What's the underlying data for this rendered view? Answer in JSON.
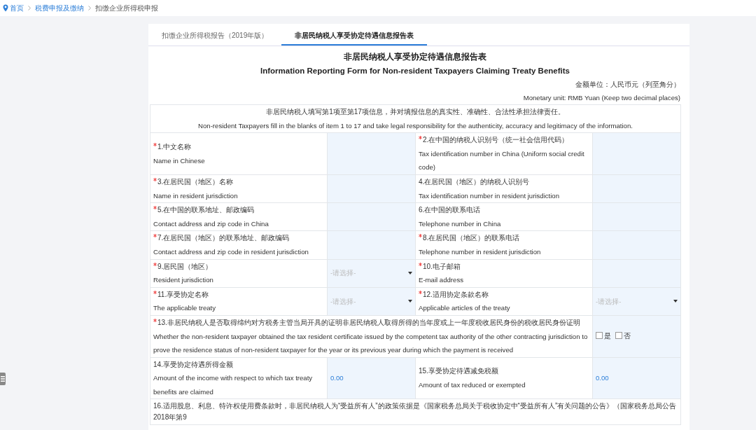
{
  "breadcrumb": [
    {
      "label": "首页",
      "kind": "home"
    },
    {
      "label": "税费申报及缴纳",
      "kind": "link"
    },
    {
      "label": "扣缴企业所得税申报",
      "kind": "current"
    }
  ],
  "tabs": [
    {
      "label": "扣缴企业所得税报告（2019年版）",
      "selected": false
    },
    {
      "label": "非居民纳税人享受协定待遇信息报告表",
      "selected": true
    }
  ],
  "form": {
    "title_zh": "非居民纳税人享受协定待遇信息报告表",
    "title_en": "Information Reporting Form for Non-resident Taxpayers Claiming Treaty Benefits",
    "unit_zh": "金额单位：人民币元（列至角分）",
    "unit_en": "Monetary unit: RMB Yuan (Keep two decimal places)",
    "notice_zh": "非居民纳税人填写第1项至第17项信息，并对填报信息的真实性、准确性、合法性承担法律责任。",
    "notice_en": "Non-resident Taxpayers fill in the blanks of item 1 to 17 and take legal responsibility for the authenticity, accuracy and legitimacy of the information.",
    "rows": [
      {
        "kind": "pair",
        "items": [
          {
            "required": true,
            "label_zh": "1.中文名称",
            "label_en": "Name in Chinese",
            "field": {
              "kind": "text"
            }
          },
          {
            "required": true,
            "label_zh": "2.在中国的纳税人识别号（统一社会信用代码）",
            "label_en": "Tax identification number in China (Uniform social credit code)",
            "field": {
              "kind": "text"
            }
          }
        ]
      },
      {
        "kind": "pair",
        "items": [
          {
            "required": true,
            "label_zh": "3.在居民国（地区）名称",
            "label_en": "Name in resident jurisdiction",
            "field": {
              "kind": "text"
            }
          },
          {
            "required": false,
            "label_zh": "4.在居民国（地区）的纳税人识别号",
            "label_en": "Tax identification number in resident jurisdiction",
            "field": {
              "kind": "text"
            }
          }
        ]
      },
      {
        "kind": "pair",
        "items": [
          {
            "required": true,
            "label_zh": "5.在中国的联系地址、邮政编码",
            "label_en": "Contact address and zip code in China",
            "field": {
              "kind": "text"
            }
          },
          {
            "required": false,
            "label_zh": "6.在中国的联系电话",
            "label_en": "Telephone number in China",
            "field": {
              "kind": "text"
            }
          }
        ]
      },
      {
        "kind": "pair",
        "items": [
          {
            "required": true,
            "label_zh": "7.在居民国（地区）的联系地址、邮政编码",
            "label_en": "Contact address and zip code in resident jurisdiction",
            "field": {
              "kind": "text"
            }
          },
          {
            "required": true,
            "label_zh": "8.在居民国（地区）的联系电话",
            "label_en": "Telephone number in resident jurisdiction",
            "field": {
              "kind": "text"
            }
          }
        ]
      },
      {
        "kind": "pair",
        "items": [
          {
            "required": true,
            "label_zh": "9.居民国（地区）",
            "label_en": "Resident jurisdiction",
            "field": {
              "kind": "select",
              "placeholder": "-请选择-"
            }
          },
          {
            "required": true,
            "label_zh": "10.电子邮箱",
            "label_en": "E-mail address",
            "field": {
              "kind": "text"
            }
          }
        ]
      },
      {
        "kind": "pair",
        "items": [
          {
            "required": true,
            "label_zh": "11.享受协定名称",
            "label_en": "The applicable treaty",
            "field": {
              "kind": "select",
              "placeholder": "-请选择-"
            }
          },
          {
            "required": true,
            "label_zh": "12.适用协定条款名称",
            "label_en": "Applicable articles of the treaty",
            "field": {
              "kind": "select",
              "placeholder": "-请选择-"
            }
          }
        ]
      },
      {
        "kind": "choice",
        "required": true,
        "label_zh": "13.非居民纳税人是否取得缔约对方税务主管当局开具的证明非居民纳税人取得所得的当年度或上一年度税收居民身份的税收居民身份证明",
        "label_en": "Whether the non-resident taxpayer obtained the tax resident certificate issued by the competent tax authority of the other contracting jurisdiction to prove the residence status of non-resident taxpayer for the year or its previous year during which the payment is received",
        "options": [
          {
            "label": "是",
            "checked": false
          },
          {
            "label": "否",
            "checked": false
          }
        ]
      },
      {
        "kind": "pair",
        "items": [
          {
            "required": false,
            "label_zh": "14.享受协定待遇所得金额",
            "label_en": "Amount of the income with respect to which tax treaty benefits are claimed",
            "field": {
              "kind": "amount",
              "value": "0.00"
            }
          },
          {
            "required": false,
            "label_zh": "15.享受协定待遇减免税额",
            "label_en": "Amount of tax reduced or exempted",
            "field": {
              "kind": "amount",
              "value": "0.00"
            }
          }
        ]
      },
      {
        "kind": "full",
        "text": "16.适用股息、利息、特许权使用费条款时，非居民纳税人为“受益所有人”的政策依据是《国家税务总局关于税收协定中“受益所有人”有关问题的公告》（国家税务总局公告2018年第9"
      }
    ]
  }
}
